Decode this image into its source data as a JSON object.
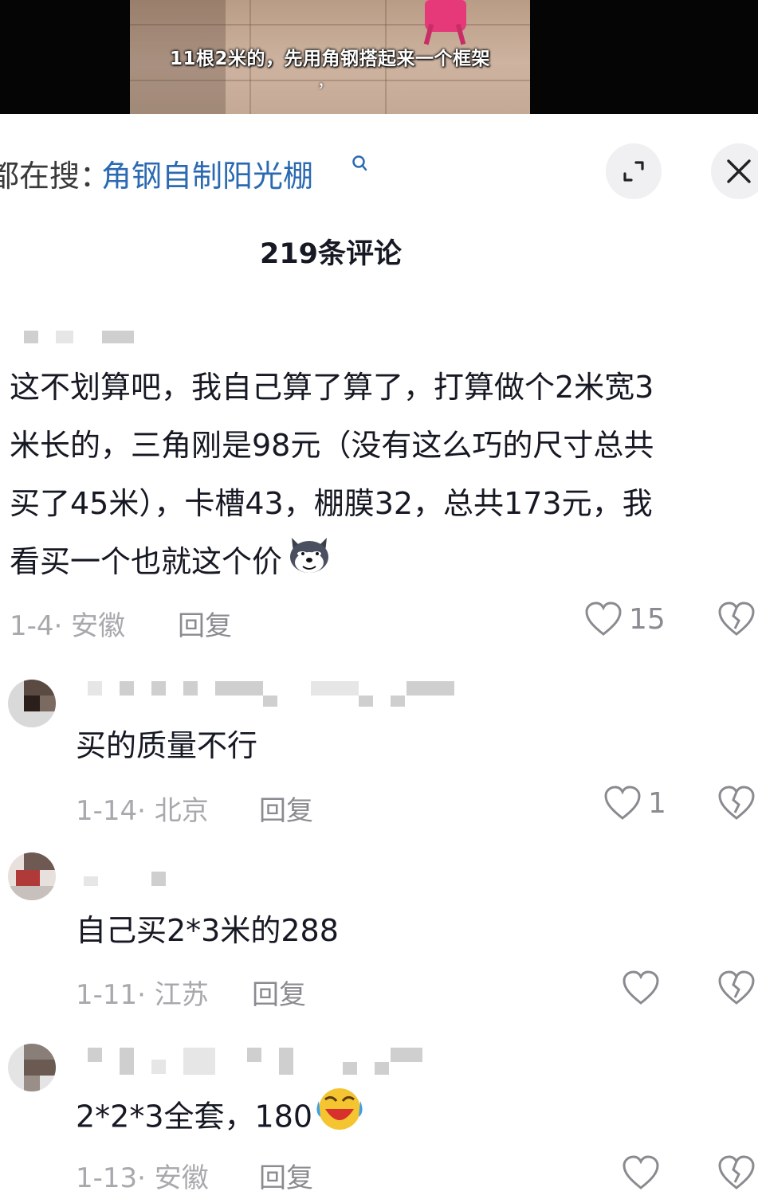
{
  "video": {
    "caption": "11根2米的，先用角钢搭起来一个框架",
    "caption_tail": "，"
  },
  "search": {
    "prefix": "都在搜：",
    "keyword": "角钢自制阳光棚",
    "search_icon": "search-icon"
  },
  "header": {
    "expand_icon": "expand-icon",
    "close_icon": "close-icon"
  },
  "comments_title": "219条评论",
  "comments": [
    {
      "text_lines": [
        "这不划算吧，我自己算了算了，打算做个2米宽3",
        "米长的，三角刚是98元（没有这么巧的尺寸总共",
        "买了45米），卡槽43，棚膜32，总共173元，我",
        "看买一个也就这个价"
      ],
      "emoji": "smug-dog-emoji",
      "date_location": "1-4· 安徽",
      "reply_label": "回复",
      "likes": "15"
    },
    {
      "text": "买的质量不行",
      "date_location": "1-14· 北京",
      "reply_label": "回复",
      "likes": "1"
    },
    {
      "text": "自己买2*3米的288",
      "date_location": "1-11· 江苏",
      "reply_label": "回复",
      "likes": ""
    },
    {
      "text": "2*2*3全套，180",
      "emoji": "laughing-crying-emoji",
      "date_location": "1-13· 安徽",
      "reply_label": "回复",
      "likes": ""
    }
  ],
  "colors": {
    "keyword_blue": "#2b6ab2",
    "meta_gray": "#a8a8ad",
    "text_dark": "#161823"
  }
}
